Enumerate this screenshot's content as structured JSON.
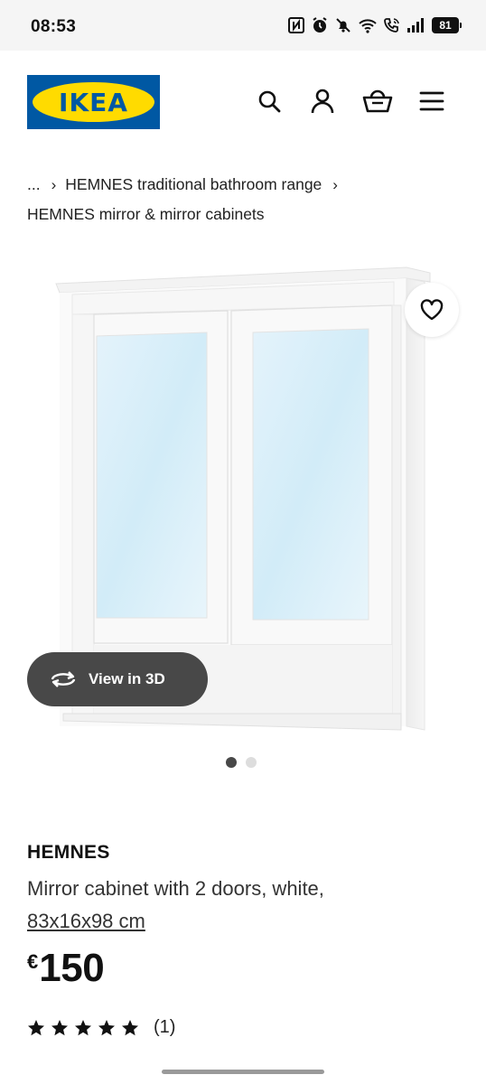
{
  "status_bar": {
    "time": "08:53",
    "battery": "81",
    "icons": [
      "nfc-icon",
      "alarm-icon",
      "mute-bell-icon",
      "wifi-icon",
      "wifi-calling-icon",
      "signal-icon",
      "battery-icon"
    ]
  },
  "header": {
    "logo_text": "IKEA",
    "icons": [
      "search-icon",
      "account-icon",
      "basket-icon",
      "menu-icon"
    ],
    "brand_blue": "#0058a3",
    "brand_yellow": "#ffdb00"
  },
  "breadcrumb": {
    "ellipsis": "...",
    "separator": "›",
    "parent": "HEMNES traditional bathroom range",
    "current": "HEMNES mirror & mirror cabinets"
  },
  "gallery": {
    "favourite_icon": "heart-icon",
    "view3d_label": "View in 3D",
    "view3d_icon": "rotate-icon",
    "total_images": 2,
    "active_image": 1
  },
  "product": {
    "name": "HEMNES",
    "description": "Mirror cabinet with 2 doors, white,",
    "size": "83x16x98 cm",
    "currency": "€",
    "price": "150",
    "rating": 5,
    "reviews": "(1)"
  }
}
